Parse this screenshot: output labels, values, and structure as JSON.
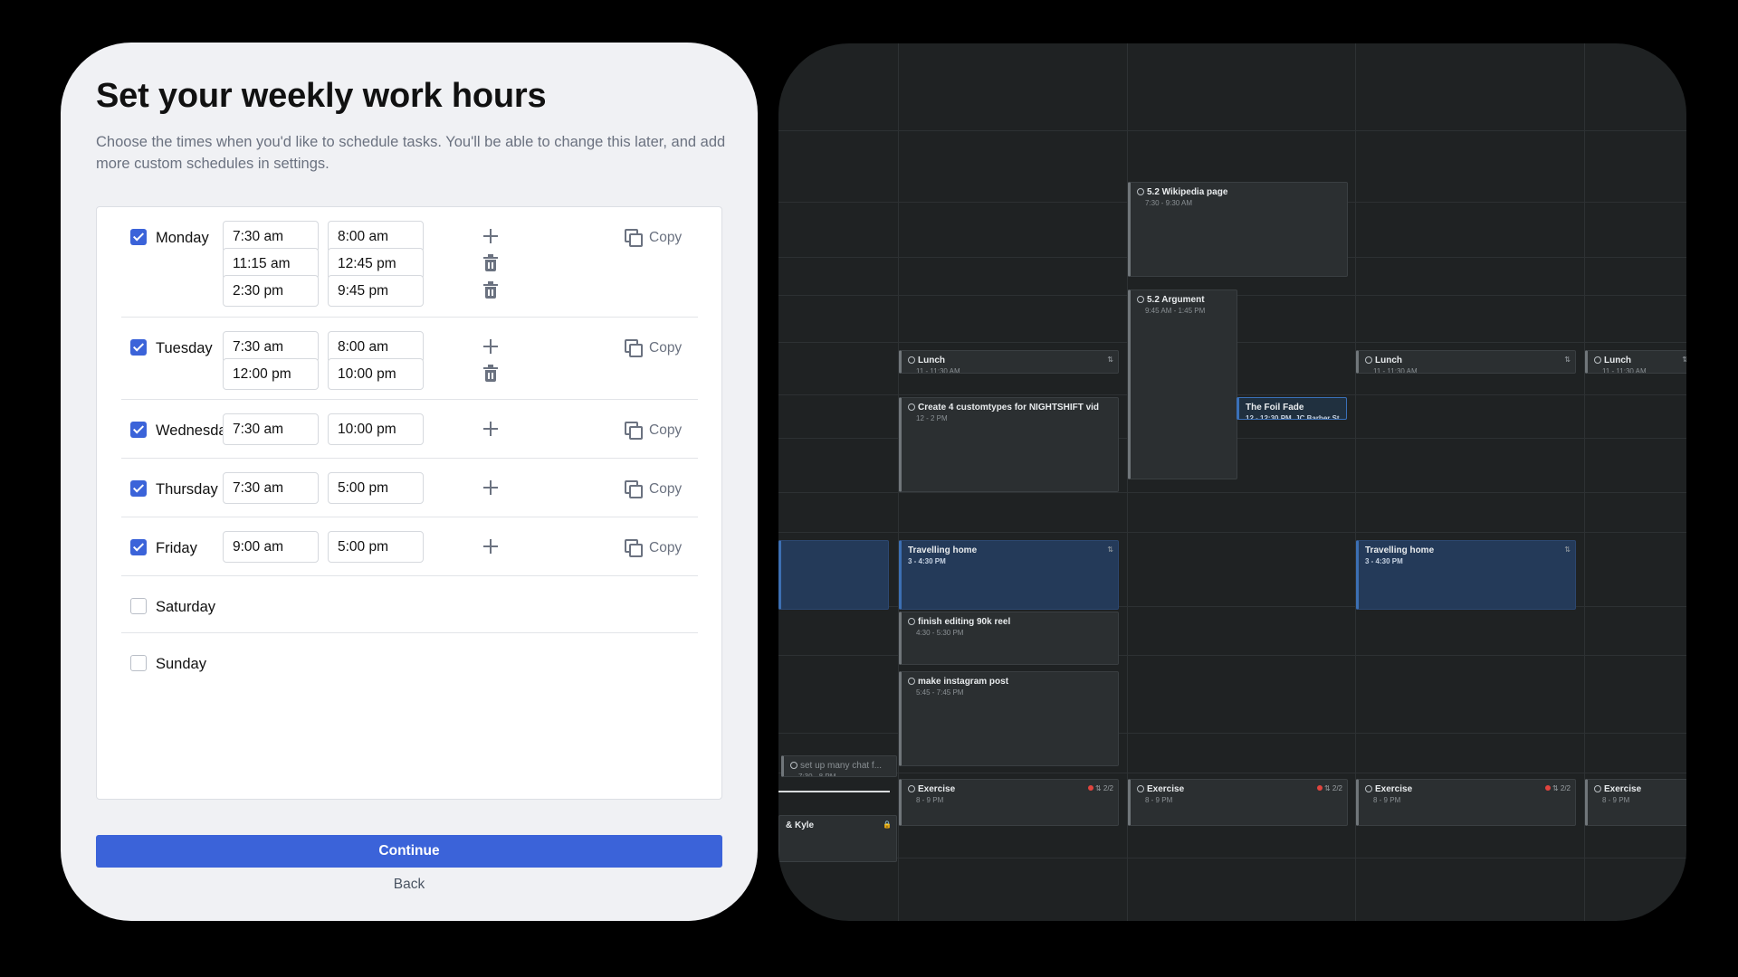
{
  "header": {
    "title": "Set your weekly work hours",
    "subtitle": "Choose the times when you'd like to schedule tasks. You'll be able to change this later, and add more custom schedules in settings."
  },
  "days": [
    {
      "name": "Monday",
      "checked": true,
      "ranges": [
        [
          "7:30 am",
          "8:00 am"
        ],
        [
          "11:15 am",
          "12:45 pm"
        ],
        [
          "2:30 pm",
          "9:45 pm"
        ]
      ]
    },
    {
      "name": "Tuesday",
      "checked": true,
      "ranges": [
        [
          "7:30 am",
          "8:00 am"
        ],
        [
          "12:00 pm",
          "10:00 pm"
        ]
      ]
    },
    {
      "name": "Wednesday",
      "checked": true,
      "ranges": [
        [
          "7:30 am",
          "10:00 pm"
        ]
      ]
    },
    {
      "name": "Thursday",
      "checked": true,
      "ranges": [
        [
          "7:30 am",
          "5:00 pm"
        ]
      ]
    },
    {
      "name": "Friday",
      "checked": true,
      "ranges": [
        [
          "9:00 am",
          "5:00 pm"
        ]
      ]
    },
    {
      "name": "Saturday",
      "checked": false,
      "ranges": []
    },
    {
      "name": "Sunday",
      "checked": false,
      "ranges": []
    }
  ],
  "labels": {
    "dash": "-",
    "copy": "Copy",
    "continue": "Continue",
    "back": "Back"
  },
  "calendar": {
    "events": [
      {
        "title": "5.2 Wikipedia page",
        "time": "7:30 - 9:30 AM"
      },
      {
        "title": "5.2 Argument",
        "time": "9:45 AM - 1:45 PM"
      },
      {
        "title": "Lunch",
        "time": "11 - 11:30 AM"
      },
      {
        "title": "Lunch",
        "time": "11 - 11:30 AM"
      },
      {
        "title": "Lunch",
        "time": "11 - 11:30 AM"
      },
      {
        "title": "Create 4 customtypes for NIGHTSHIFT vid",
        "time": "12 - 2 PM"
      },
      {
        "title": "The Foil Fade",
        "time": "12 - 12:30 PM, JC Barber St"
      },
      {
        "title": "Travelling home",
        "time": "3 - 4:30 PM"
      },
      {
        "title": "Travelling home",
        "time": "3 - 4:30 PM"
      },
      {
        "title": "finish editing 90k reel",
        "time": "4:30 - 5:30 PM"
      },
      {
        "title": "make instagram post",
        "time": "5:45 - 7:45 PM"
      },
      {
        "title": "set up many chat f...",
        "time": "7:30 - 8 PM"
      },
      {
        "title": "Exercise",
        "time": "8 - 9 PM",
        "badge": "2/2"
      },
      {
        "title": "Exercise",
        "time": "8 - 9 PM",
        "badge": "2/2"
      },
      {
        "title": "Exercise",
        "time": "8 - 9 PM",
        "badge": "2/2"
      },
      {
        "title": "Exercise",
        "time": "8 - 9 PM"
      },
      {
        "title": "& Kyle",
        "time": ""
      }
    ]
  }
}
